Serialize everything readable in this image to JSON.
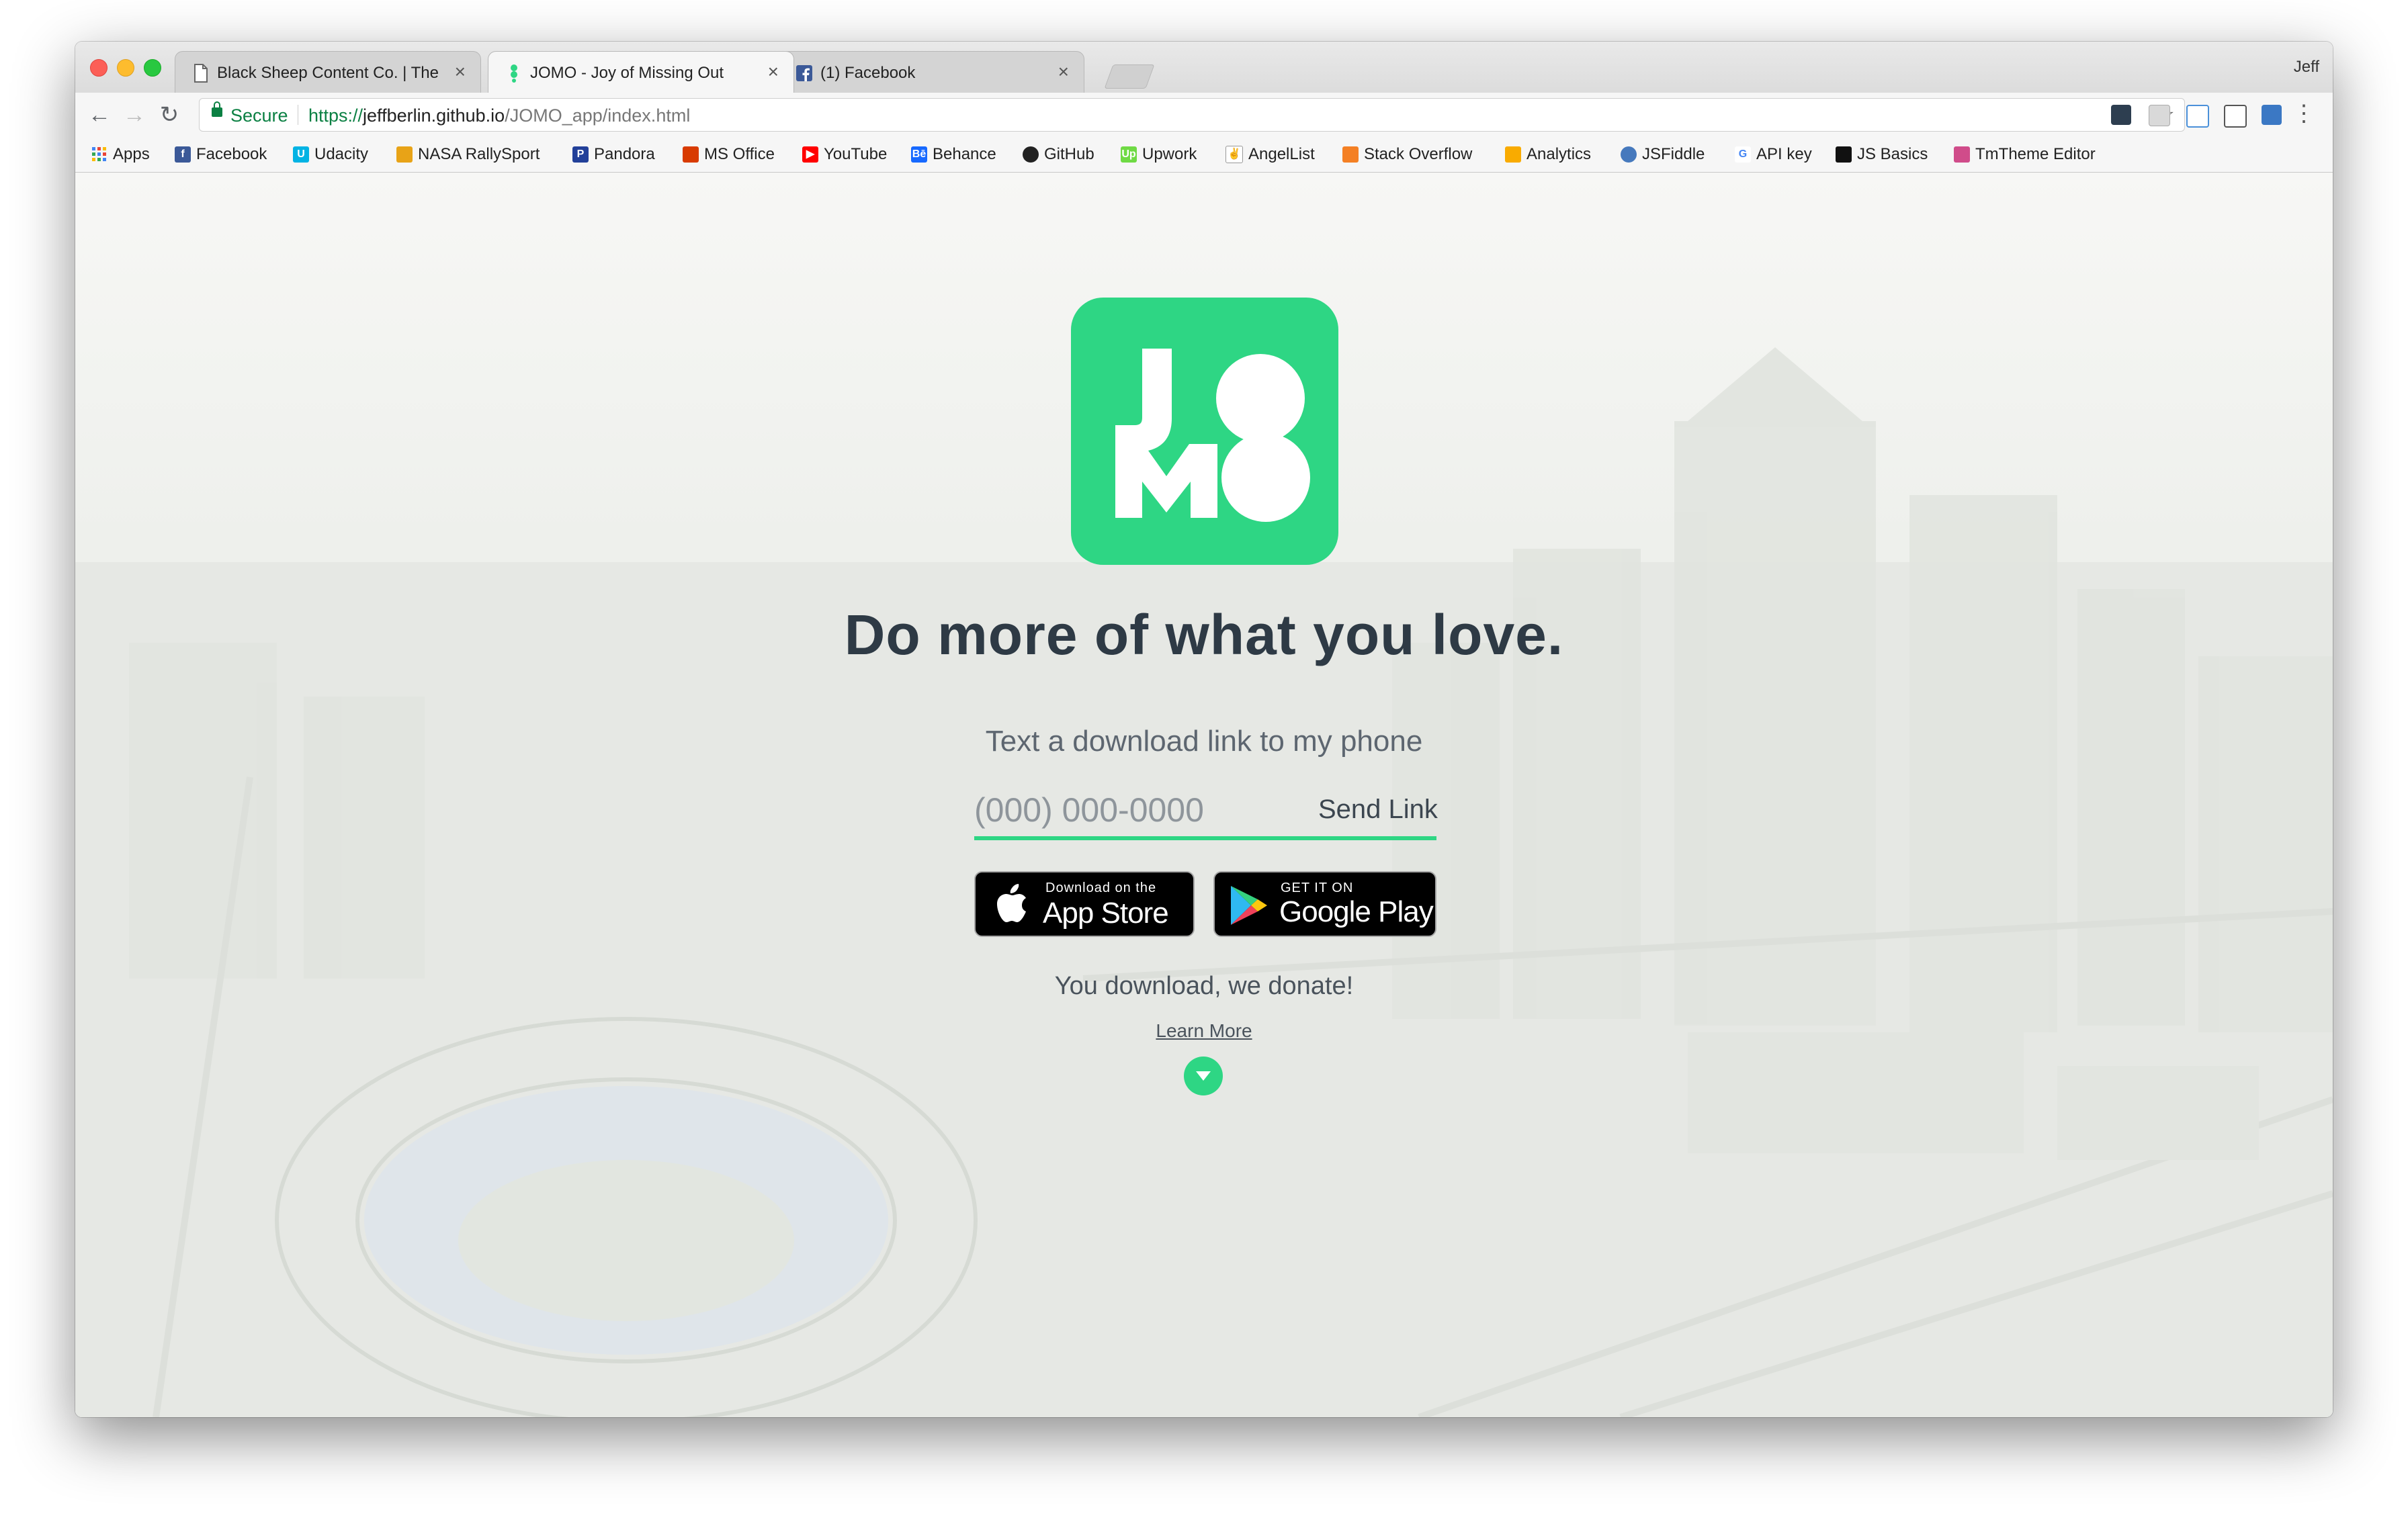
{
  "browser": {
    "user_name": "Jeff",
    "tabs": [
      {
        "label": "Black Sheep Content Co. | The",
        "icon": "page-icon",
        "active": false
      },
      {
        "label": "JOMO - Joy of Missing Out",
        "icon": "jomo-favicon",
        "active": true
      },
      {
        "label": "(1) Facebook",
        "icon": "facebook-icon",
        "active": false
      }
    ],
    "tab_close": "×",
    "address": {
      "secure_label": "Secure",
      "url_scheme": "https://",
      "url_host": "jeffberlin.github.io",
      "url_path": "/JOMO_app/index.html"
    },
    "nav": {
      "back": "←",
      "forward": "→",
      "reload": "↻",
      "star": "☆",
      "menu": "⋮"
    },
    "bookmarks": [
      {
        "label": "Apps",
        "icon": "apps-grid-icon",
        "color": "#4285f4"
      },
      {
        "label": "Facebook",
        "icon": "facebook-icon",
        "color": "#3b5998"
      },
      {
        "label": "Udacity",
        "icon": "udacity-icon",
        "color": "#02b3e4"
      },
      {
        "label": "NASA RallySport",
        "icon": "nasa-icon",
        "color": "#e8a317"
      },
      {
        "label": "Pandora",
        "icon": "pandora-icon",
        "color": "#224099"
      },
      {
        "label": "MS Office",
        "icon": "office-icon",
        "color": "#d83b01"
      },
      {
        "label": "YouTube",
        "icon": "youtube-icon",
        "color": "#ff0000"
      },
      {
        "label": "Behance",
        "icon": "behance-icon",
        "color": "#1769ff"
      },
      {
        "label": "GitHub",
        "icon": "github-icon",
        "color": "#222222"
      },
      {
        "label": "Upwork",
        "icon": "upwork-icon",
        "color": "#6fda44"
      },
      {
        "label": "AngelList",
        "icon": "angellist-icon",
        "color": "#333333"
      },
      {
        "label": "Stack Overflow",
        "icon": "stackoverflow-icon",
        "color": "#f48024"
      },
      {
        "label": "Analytics",
        "icon": "analytics-icon",
        "color": "#f9ab00"
      },
      {
        "label": "JSFiddle",
        "icon": "jsfiddle-icon",
        "color": "#4679bd"
      },
      {
        "label": "API key",
        "icon": "google-icon",
        "color": "#4285f4"
      },
      {
        "label": "JS Basics",
        "icon": "jsbasics-icon",
        "color": "#111111"
      },
      {
        "label": "TmTheme Editor",
        "icon": "tmtheme-icon",
        "color": "#d04c8a"
      }
    ]
  },
  "page": {
    "logo": {
      "letters": [
        "J",
        "O",
        "M",
        "O"
      ],
      "color": "#2ed684",
      "name": "JOMO"
    },
    "headline": "Do more of what you love.",
    "subheading": "Text a download link to my phone",
    "phone_placeholder": "(000) 000-0000",
    "send_link_label": "Send Link",
    "app_store": {
      "small": "Download on the",
      "big": "App Store"
    },
    "google_play": {
      "small": "GET IT ON",
      "big": "Google Play"
    },
    "donate_text": "You download, we donate!",
    "learn_more": "Learn More",
    "accent_color": "#2ed684",
    "text_color": "#2e3a45"
  }
}
